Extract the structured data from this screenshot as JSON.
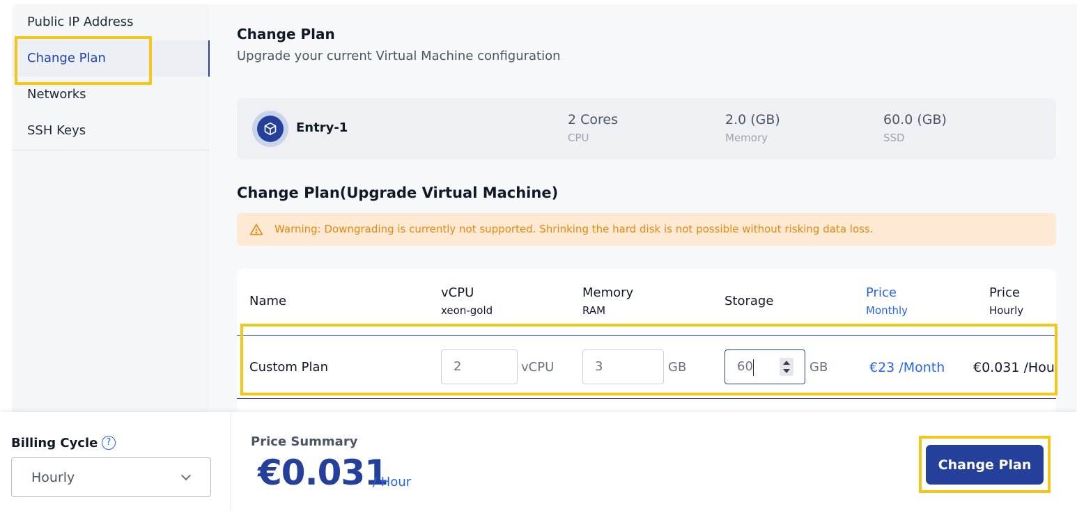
{
  "sidebar": {
    "items": [
      {
        "label": "Public IP Address",
        "active": false
      },
      {
        "label": "Change Plan",
        "active": true
      },
      {
        "label": "Networks",
        "active": false
      },
      {
        "label": "SSH Keys",
        "active": false
      }
    ]
  },
  "header": {
    "title": "Change Plan",
    "subtitle": "Upgrade your current Virtual Machine configuration"
  },
  "current_plan": {
    "name": "Entry-1",
    "icon": "cube-icon",
    "specs": [
      {
        "value": "2 Cores",
        "label": "CPU"
      },
      {
        "value": "2.0 (GB)",
        "label": "Memory"
      },
      {
        "value": "60.0 (GB)",
        "label": "SSD"
      }
    ]
  },
  "upgrade": {
    "title": "Change Plan(Upgrade Virtual Machine)",
    "warning": "Warning: Downgrading is currently not supported. Shrinking the hard disk is not possible without risking data loss.",
    "columns": [
      {
        "label": "Name",
        "sub": ""
      },
      {
        "label": "vCPU",
        "sub": "xeon-gold"
      },
      {
        "label": "Memory",
        "sub": "RAM"
      },
      {
        "label": "Storage",
        "sub": ""
      },
      {
        "label": "Price",
        "sub": "Monthly"
      },
      {
        "label": "Price",
        "sub": "Hourly"
      }
    ],
    "row": {
      "name": "Custom Plan",
      "vcpu": "2",
      "vcpu_unit": "vCPU",
      "memory": "3",
      "memory_unit": "GB",
      "storage": "60",
      "storage_unit": "GB",
      "price_monthly": "€23  /Month",
      "price_hourly": "€0.031  /Hou"
    }
  },
  "billing": {
    "label": "Billing Cycle",
    "help_icon": "question-circle-icon",
    "selected": "Hourly"
  },
  "summary": {
    "label": "Price Summary",
    "amount": "€0.031",
    "unit": "/ Hour"
  },
  "actions": {
    "change_plan": "Change Plan"
  },
  "colors": {
    "primary": "#24409b",
    "highlight": "#f5c518",
    "warning_bg": "#fde9d4",
    "warning_text": "#e58a0f"
  }
}
